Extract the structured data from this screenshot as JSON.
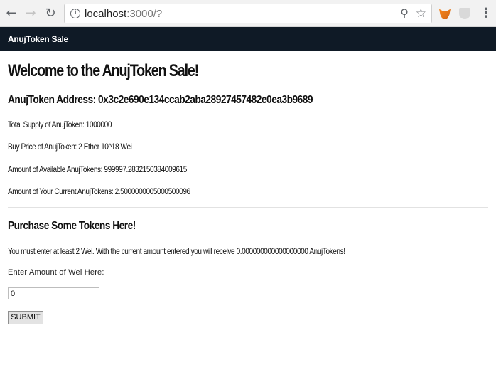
{
  "browser": {
    "url_host": "localhost",
    "url_rest": ":3000/?"
  },
  "navbar": {
    "brand": "AnujToken Sale"
  },
  "main": {
    "heading": "Welcome to the AnujToken Sale!",
    "token_address": "AnujToken Address: 0x3c2e690e134ccab2aba28927457482e0ea3b9689",
    "total_supply": "Total Supply of AnujToken: 1000000",
    "buy_price": "Buy Price of AnujToken: 2 Ether 10^18 Wei",
    "available": "Amount of Available AnujTokens: 999997.2832150384009615",
    "current": "Amount of Your Current AnujTokens: 2.5000000005000500096"
  },
  "purchase": {
    "heading": "Purchase Some Tokens Here!",
    "note": "You must enter at least 2 Wei. With the current amount entered you will receive 0.000000000000000000 AnujTokens!",
    "label": "Enter Amount of Wei Here:",
    "input_value": "0",
    "submit_label": "SUBMIT"
  }
}
